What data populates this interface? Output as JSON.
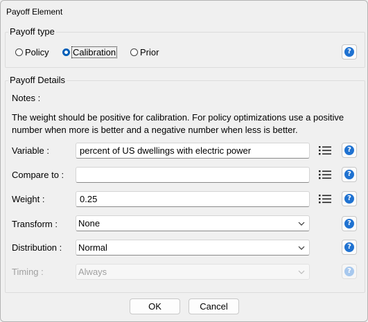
{
  "window": {
    "title": "Payoff Element"
  },
  "payoff_type": {
    "legend": "Payoff type",
    "options": [
      {
        "label": "Policy",
        "checked": false
      },
      {
        "label": "Calibration",
        "checked": true
      },
      {
        "label": "Prior",
        "checked": false
      }
    ]
  },
  "details": {
    "legend": "Payoff Details",
    "notes_label": "Notes :",
    "notes_line1": "The weight should be positive for calibration.  For policy optimizations use a positive",
    "notes_line2": "number when more is better and a negative number when less is better.",
    "variable": {
      "label": "Variable :",
      "value": "percent of US dwellings with electric power"
    },
    "compare": {
      "label": "Compare to :",
      "value": ""
    },
    "weight": {
      "label": "Weight :",
      "value": "0.25"
    },
    "transform": {
      "label": "Transform :",
      "value": "None"
    },
    "distribution": {
      "label": "Distribution :",
      "value": "Normal"
    },
    "timing": {
      "label": "Timing :",
      "value": "Always",
      "enabled": false
    }
  },
  "buttons": {
    "ok": "OK",
    "cancel": "Cancel"
  },
  "icons": {
    "help": "?",
    "help_icon_name": "help-icon",
    "list_icon_name": "list-icon",
    "chevron_icon_name": "chevron-down-icon"
  },
  "colors": {
    "accent": "#005fb8",
    "help": "#1f72d1"
  }
}
